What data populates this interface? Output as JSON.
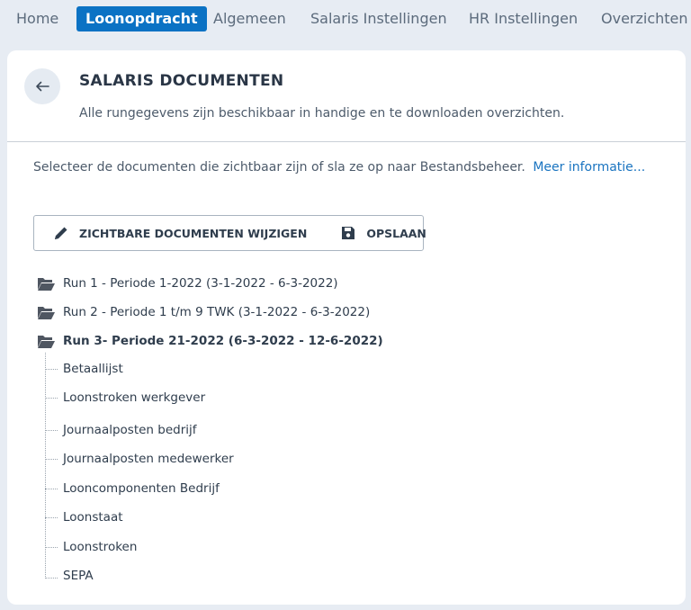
{
  "nav": {
    "items": [
      {
        "label": "Home",
        "active": false
      },
      {
        "label": "Loonopdracht",
        "active": true
      },
      {
        "label": "Algemeen",
        "active": false
      },
      {
        "label": "Salaris Instellingen",
        "active": false
      },
      {
        "label": "HR Instellingen",
        "active": false
      },
      {
        "label": "Overzichten",
        "active": false
      }
    ]
  },
  "header": {
    "back_icon": "arrow-left-icon",
    "title": "SALARIS DOCUMENTEN",
    "subtitle": "Alle rungegevens zijn beschikbaar in handige en te downloaden overzichten."
  },
  "info": {
    "text": "Selecteer de documenten die zichtbaar zijn of sla ze op naar Bestandsbeheer.",
    "link": "Meer informatie..."
  },
  "toolbar": {
    "edit_label": "ZICHTBARE DOCUMENTEN WIJZIGEN",
    "edit_icon": "pencil-icon",
    "save_label": "OPSLAAN",
    "save_icon": "floppy-disk-icon"
  },
  "tree": {
    "runs": [
      {
        "label": "Run 1 - Periode 1-2022 (3-1-2022 - 6-3-2022)",
        "expanded": false
      },
      {
        "label": "Run 2 - Periode 1 t/m 9 TWK (3-1-2022 - 6-3-2022)",
        "expanded": false
      },
      {
        "label": "Run 3- Periode 21-2022 (6-3-2022 - 12-6-2022)",
        "expanded": true
      }
    ],
    "documents": [
      "Betaallijst",
      "Loonstroken werkgever",
      "Journaalposten bedrijf",
      "Journaalposten medewerker",
      "Looncomponenten Bedrijf",
      "Loonstaat",
      "Loonstroken",
      "SEPA"
    ],
    "folder_icon": "folder-open-icon"
  },
  "colors": {
    "accent": "#0b72c4",
    "page_bg": "#e7ecf3",
    "link": "#1a74c0"
  }
}
